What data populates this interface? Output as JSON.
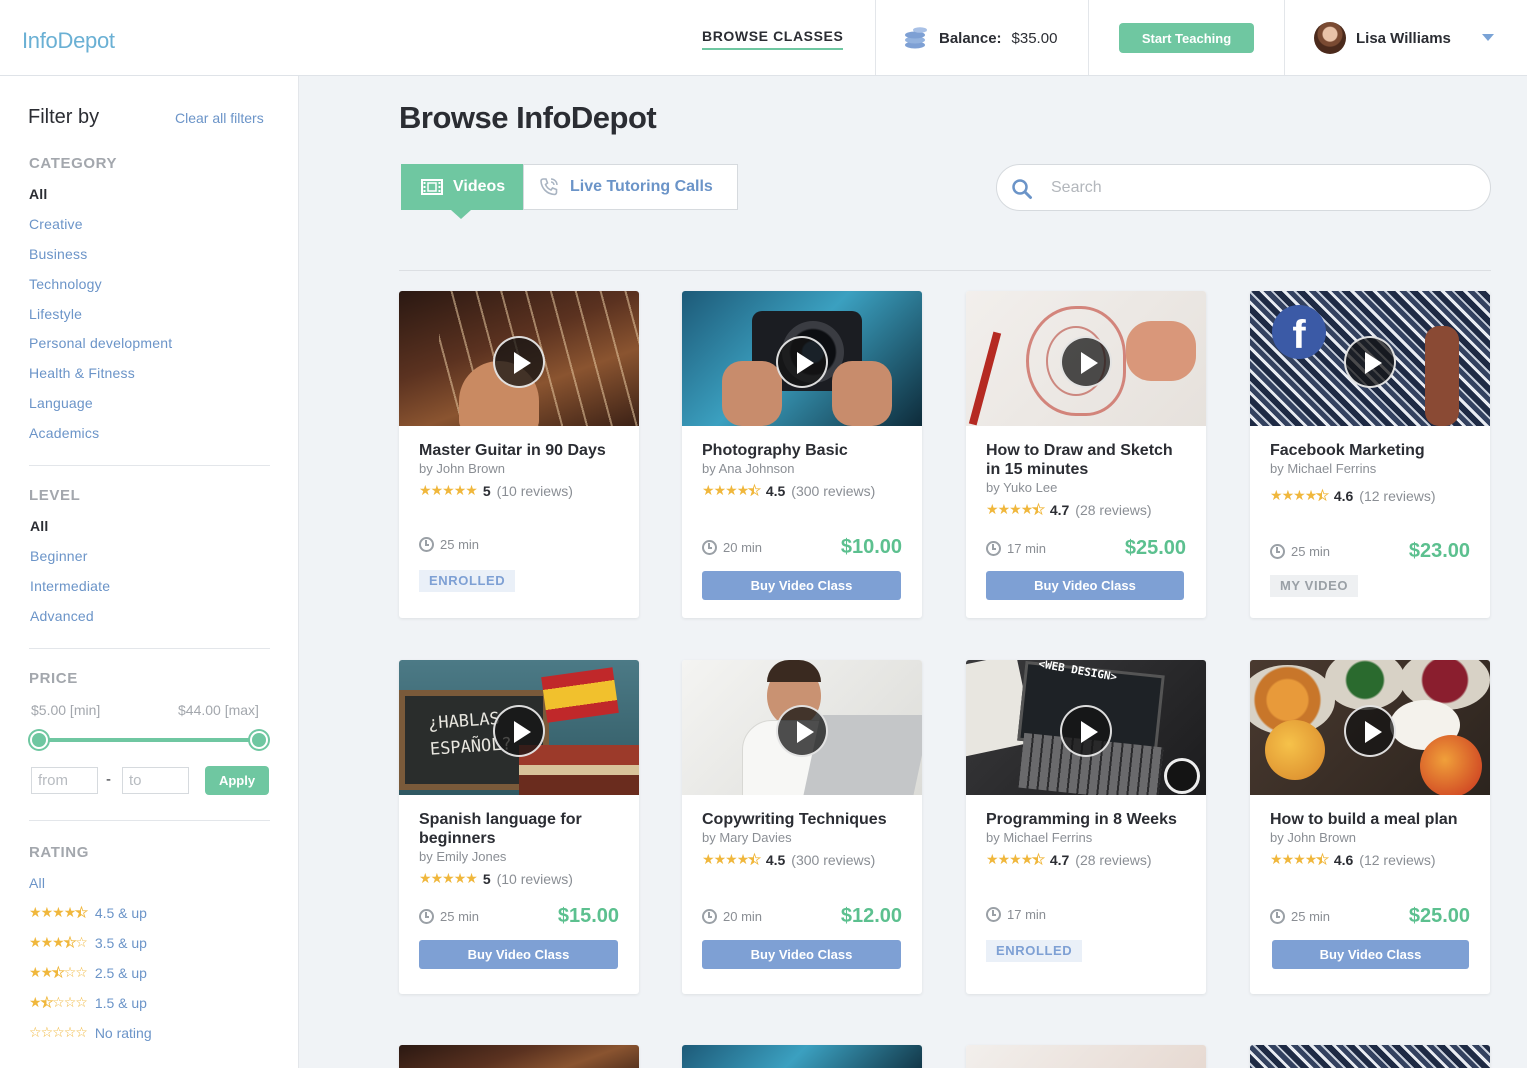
{
  "header": {
    "logo": "InfoDepot",
    "nav_browse": "BROWSE CLASSES",
    "balance_label": "Balance:",
    "balance_amount": "$35.00",
    "start_teaching": "Start Teaching",
    "user_name": "Lisa Williams"
  },
  "sidebar": {
    "title": "Filter by",
    "clear": "Clear all filters",
    "category_head": "CATEGORY",
    "categories": [
      "All",
      "Creative",
      "Business",
      "Technology",
      "Lifestyle",
      "Personal development",
      "Health & Fitness",
      "Language",
      "Academics"
    ],
    "level_head": "LEVEL",
    "levels": [
      "All",
      "Beginner",
      "Intermediate",
      "Advanced"
    ],
    "price_head": "PRICE",
    "price_min": "$5.00 [min]",
    "price_max": "$44.00 [max]",
    "from_placeholder": "from",
    "to_placeholder": "to",
    "dash": "-",
    "apply": "Apply",
    "rating_head": "RATING",
    "rating_all": "All",
    "ratings": [
      {
        "label": "4.5 & up",
        "stars": 4.5
      },
      {
        "label": "3.5 & up",
        "stars": 3.5
      },
      {
        "label": "2.5 & up",
        "stars": 2.5
      },
      {
        "label": "1.5 & up",
        "stars": 1.5
      },
      {
        "label": "No rating",
        "stars": 0
      }
    ]
  },
  "main": {
    "title": "Browse InfoDepot",
    "tab_videos": "Videos",
    "tab_live": "Live Tutoring Calls",
    "search_placeholder": "Search"
  },
  "cards": [
    {
      "title": "Master Guitar in 90 Days",
      "author": "by John Brown",
      "stars": 5,
      "score": "5",
      "reviews": "(10 reviews)",
      "duration": "25 min",
      "price": "",
      "action": "ENROLLED"
    },
    {
      "title": "Photography Basic",
      "author": "by Ana Johnson",
      "stars": 4.5,
      "score": "4.5",
      "reviews": "(300 reviews)",
      "duration": "20 min",
      "price": "$10.00",
      "action": "Buy Video Class"
    },
    {
      "title": "How to Draw and Sketch in 15 minutes",
      "author": "by Yuko Lee",
      "stars": 4.5,
      "score": "4.7",
      "reviews": "(28 reviews)",
      "duration": "17 min",
      "price": "$25.00",
      "action": "Buy Video Class"
    },
    {
      "title": "Facebook Marketing",
      "author": "by Michael Ferrins",
      "stars": 4.5,
      "score": "4.6",
      "reviews": "(12 reviews)",
      "duration": "25 min",
      "price": "$23.00",
      "action": "MY VIDEO"
    },
    {
      "title": "Spanish language for beginners",
      "author": "by Emily Jones",
      "stars": 5,
      "score": "5",
      "reviews": "(10 reviews)",
      "duration": "25 min",
      "price": "$15.00",
      "action": "Buy Video Class"
    },
    {
      "title": "Copywriting Techniques",
      "author": "by Mary Davies",
      "stars": 4.5,
      "score": "4.5",
      "reviews": "(300 reviews)",
      "duration": "20 min",
      "price": "$12.00",
      "action": "Buy Video Class"
    },
    {
      "title": "Programming in 8 Weeks",
      "author": "by Michael Ferrins",
      "stars": 4.5,
      "score": "4.7",
      "reviews": "(28 reviews)",
      "duration": "17 min",
      "price": "",
      "action": "ENROLLED"
    },
    {
      "title": "How to build a meal plan",
      "author": "by John Brown",
      "stars": 4.5,
      "score": "4.6",
      "reviews": "(12 reviews)",
      "duration": "25 min",
      "price": "$25.00",
      "action": "Buy Video Class"
    }
  ],
  "colors": {
    "accent_green": "#6fc7a1",
    "link_blue": "#6b94c8",
    "button_blue": "#7ea0d4",
    "price_green": "#5cc08f",
    "star_gold": "#f0b73c"
  }
}
